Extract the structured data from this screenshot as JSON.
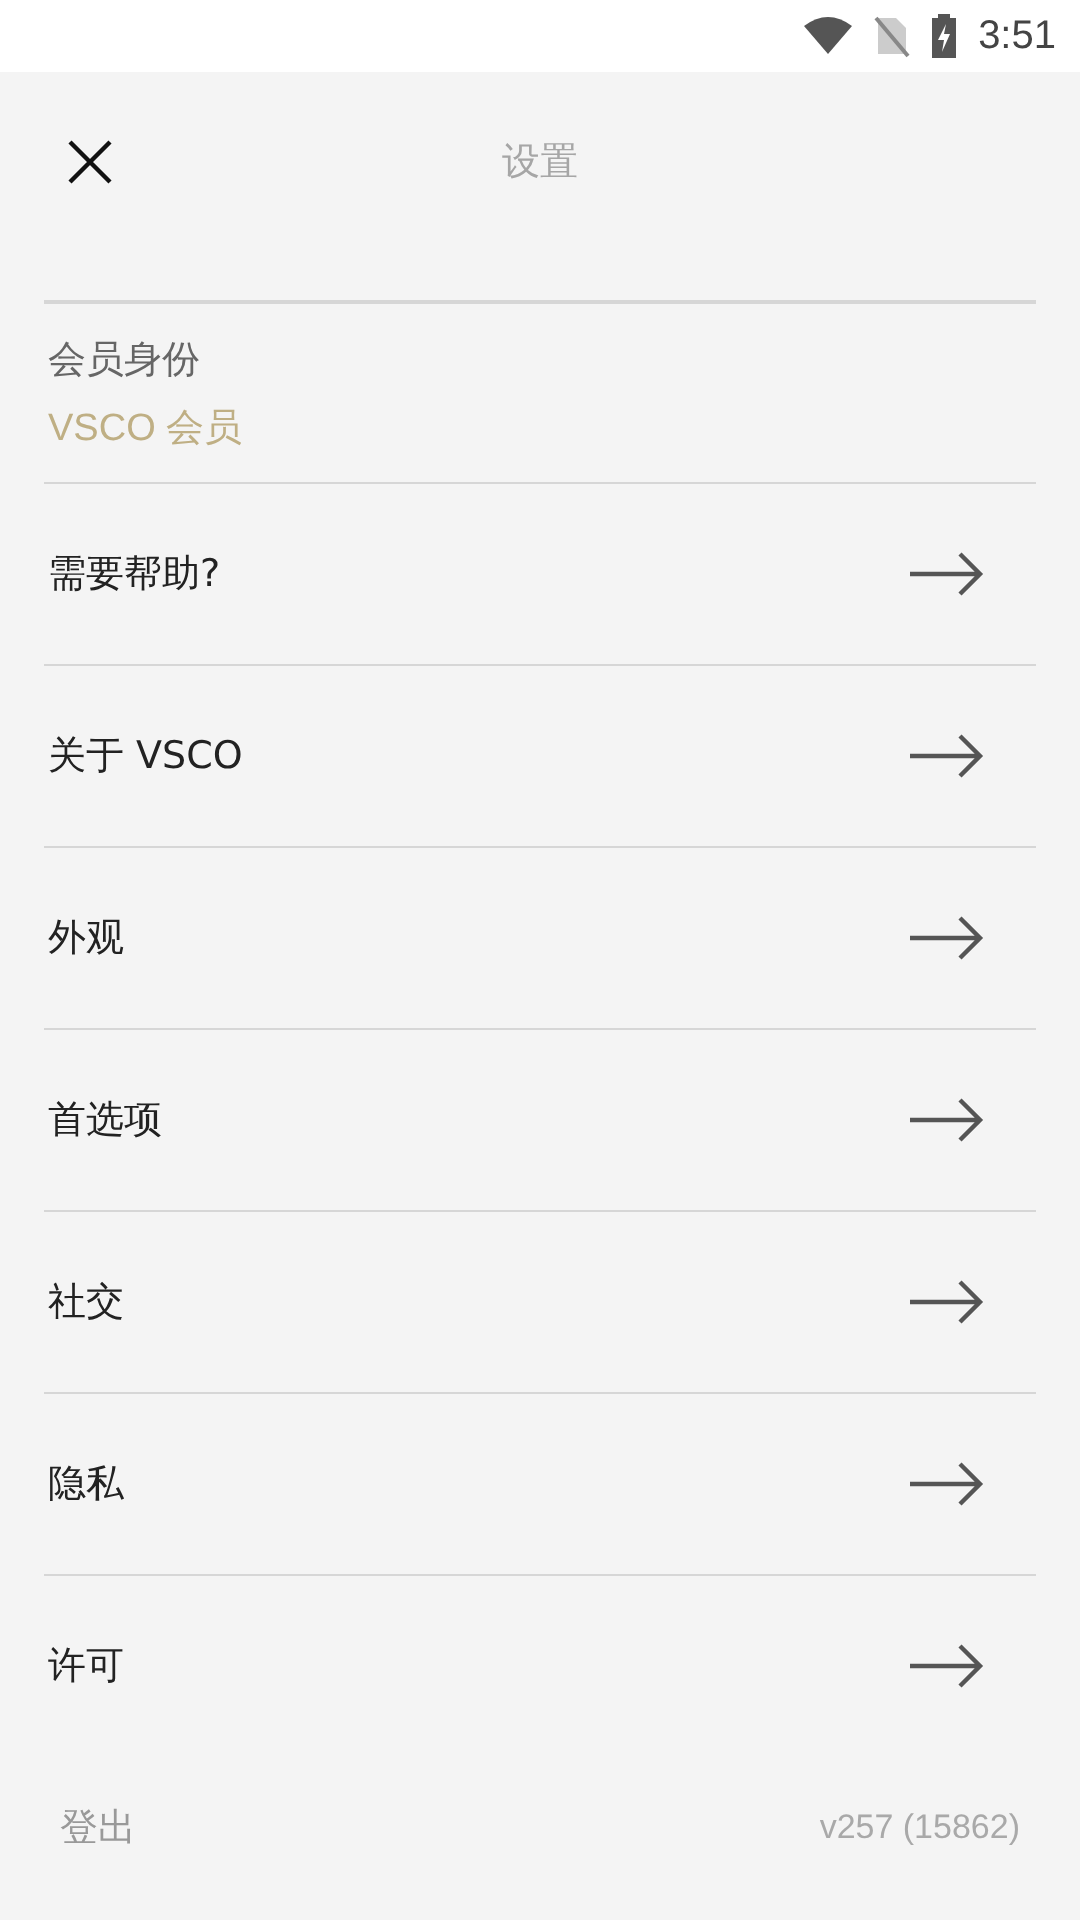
{
  "status_bar": {
    "time": "3:51"
  },
  "header": {
    "title": "设置"
  },
  "membership": {
    "label": "会员身份",
    "value": "VSCO 会员"
  },
  "items": [
    {
      "label": "需要帮助?"
    },
    {
      "label": "关于 VSCO"
    },
    {
      "label": "外观"
    },
    {
      "label": "首选项"
    },
    {
      "label": "社交"
    },
    {
      "label": "隐私"
    },
    {
      "label": "许可"
    }
  ],
  "footer": {
    "logout": "登出",
    "version": "v257 (15862)"
  }
}
